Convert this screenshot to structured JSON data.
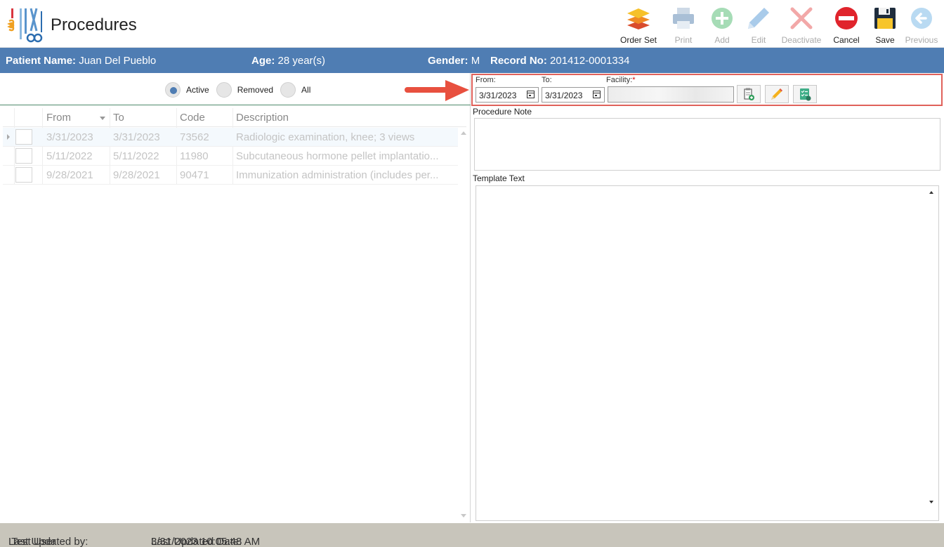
{
  "header": {
    "title": "Procedures",
    "logo_icon": "surgical-instruments-icon"
  },
  "toolbar": {
    "order_set": "Order Set",
    "print": "Print",
    "add": "Add",
    "edit": "Edit",
    "deactivate": "Deactivate",
    "cancel": "Cancel",
    "save": "Save",
    "previous": "Previous"
  },
  "patient": {
    "name_label": "Patient Name:",
    "name": "Juan Del Pueblo",
    "age_label": "Age:",
    "age": "28 year(s)",
    "gender_label": "Gender:",
    "gender": "M",
    "record_label": "Record No:",
    "record": "201412-0001334"
  },
  "filter": {
    "active": "Active",
    "removed": "Removed",
    "all": "All",
    "selected": "Active"
  },
  "grid": {
    "columns": [
      "From",
      "To",
      "Code",
      "Description"
    ],
    "rows": [
      {
        "from": "3/31/2023",
        "to": "3/31/2023",
        "code": "73562",
        "description": "Radiologic examination, knee; 3 views"
      },
      {
        "from": "5/11/2022",
        "to": "5/11/2022",
        "code": "11980",
        "description": "Subcutaneous hormone pellet implantatio..."
      },
      {
        "from": "9/28/2021",
        "to": "9/28/2021",
        "code": "90471",
        "description": "Immunization administration (includes per..."
      }
    ]
  },
  "editor": {
    "from_label": "From:",
    "from_value": "3/31/2023",
    "to_label": "To:",
    "to_value": "3/31/2023",
    "facility_label": "Facility:",
    "facility_required": "*",
    "procedure_note_label": "Procedure Note",
    "template_text_label": "Template Text"
  },
  "footer": {
    "updated_by_label": "Last Updated by:",
    "updated_by": "Test User",
    "updated_date_label": "Last Updated Date:",
    "updated_date": "3/31/2023 10:05:48 AM"
  },
  "colors": {
    "patient_bar": "#4f7db3",
    "footer": "#c8c5bb",
    "callout": "#e0615a"
  }
}
